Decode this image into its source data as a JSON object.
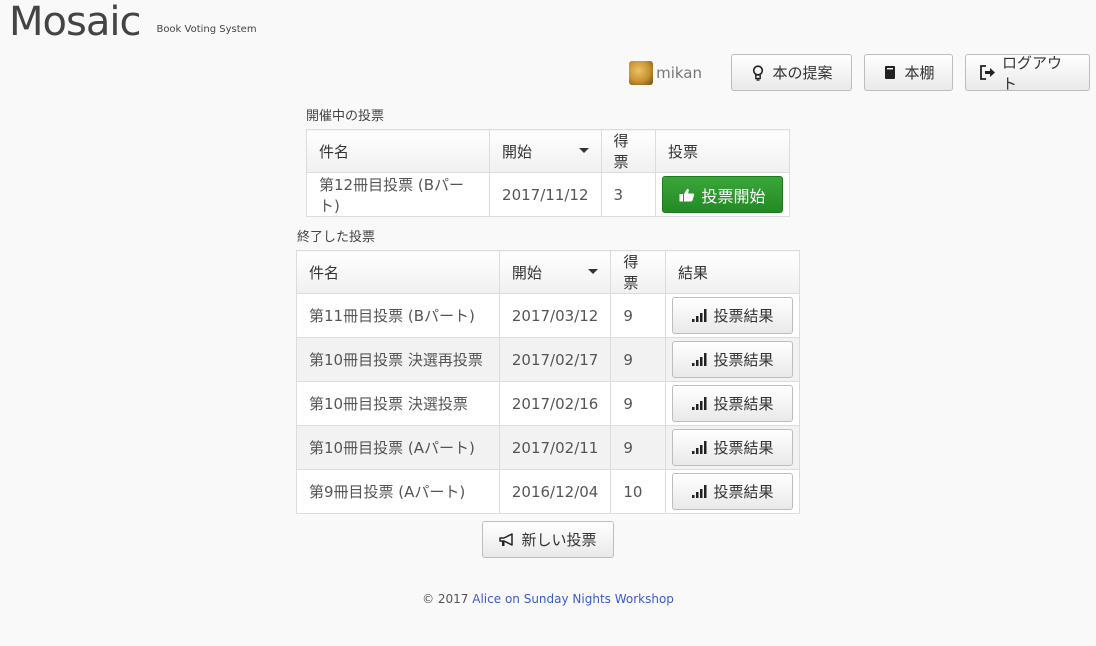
{
  "brand": {
    "title": "Mosaic",
    "subtitle": "Book Voting System"
  },
  "user": {
    "name": "mikan"
  },
  "nav": {
    "propose_label": "本の提案",
    "shelf_label": "本棚",
    "logout_label": "ログアウト"
  },
  "open_votes": {
    "title": "開催中の投票",
    "headers": {
      "name": "件名",
      "start": "開始",
      "votes": "得票",
      "action": "投票"
    },
    "rows": [
      {
        "name": "第12冊目投票 (Bパート)",
        "start": "2017/11/12",
        "votes": "3",
        "action": "投票開始"
      }
    ]
  },
  "closed_votes": {
    "title": "終了した投票",
    "headers": {
      "name": "件名",
      "start": "開始",
      "votes": "得票",
      "result": "結果"
    },
    "rows": [
      {
        "name": "第11冊目投票 (Bパート)",
        "start": "2017/03/12",
        "votes": "9",
        "result": "投票結果"
      },
      {
        "name": "第10冊目投票 決選再投票",
        "start": "2017/02/17",
        "votes": "9",
        "result": "投票結果"
      },
      {
        "name": "第10冊目投票 決選投票",
        "start": "2017/02/16",
        "votes": "9",
        "result": "投票結果"
      },
      {
        "name": "第10冊目投票 (Aパート)",
        "start": "2017/02/11",
        "votes": "9",
        "result": "投票結果"
      },
      {
        "name": "第9冊目投票 (Aパート)",
        "start": "2016/12/04",
        "votes": "10",
        "result": "投票結果"
      }
    ]
  },
  "new_vote_label": "新しい投票",
  "footer": {
    "copyright": "© 2017",
    "link_text": "Alice on Sunday Nights Workshop"
  },
  "colors": {
    "green": "#2a9a2a",
    "link": "#3a5bd0"
  },
  "icons": {
    "propose": "lightbulb-icon",
    "shelf": "book-icon",
    "logout": "logout-icon",
    "start_vote": "thumbs-up-icon",
    "result": "signal-bars-icon",
    "new_vote": "megaphone-icon"
  }
}
